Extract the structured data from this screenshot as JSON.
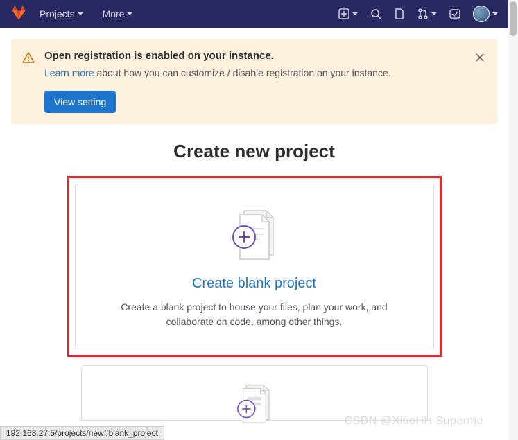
{
  "nav": {
    "projects": "Projects",
    "more": "More"
  },
  "alert": {
    "title": "Open registration is enabled on your instance.",
    "learn_more": "Learn more",
    "desc_rest": " about how you can customize / disable registration on your instance.",
    "button": "View setting"
  },
  "page": {
    "title": "Create new project"
  },
  "card1": {
    "title": "Create blank project",
    "desc": "Create a blank project to house your files, plan your work, and collaborate on code, among other things."
  },
  "watermark": "CSDN @XiaoHH Superme",
  "statusbar": "192.168.27.5/projects/new#blank_project"
}
